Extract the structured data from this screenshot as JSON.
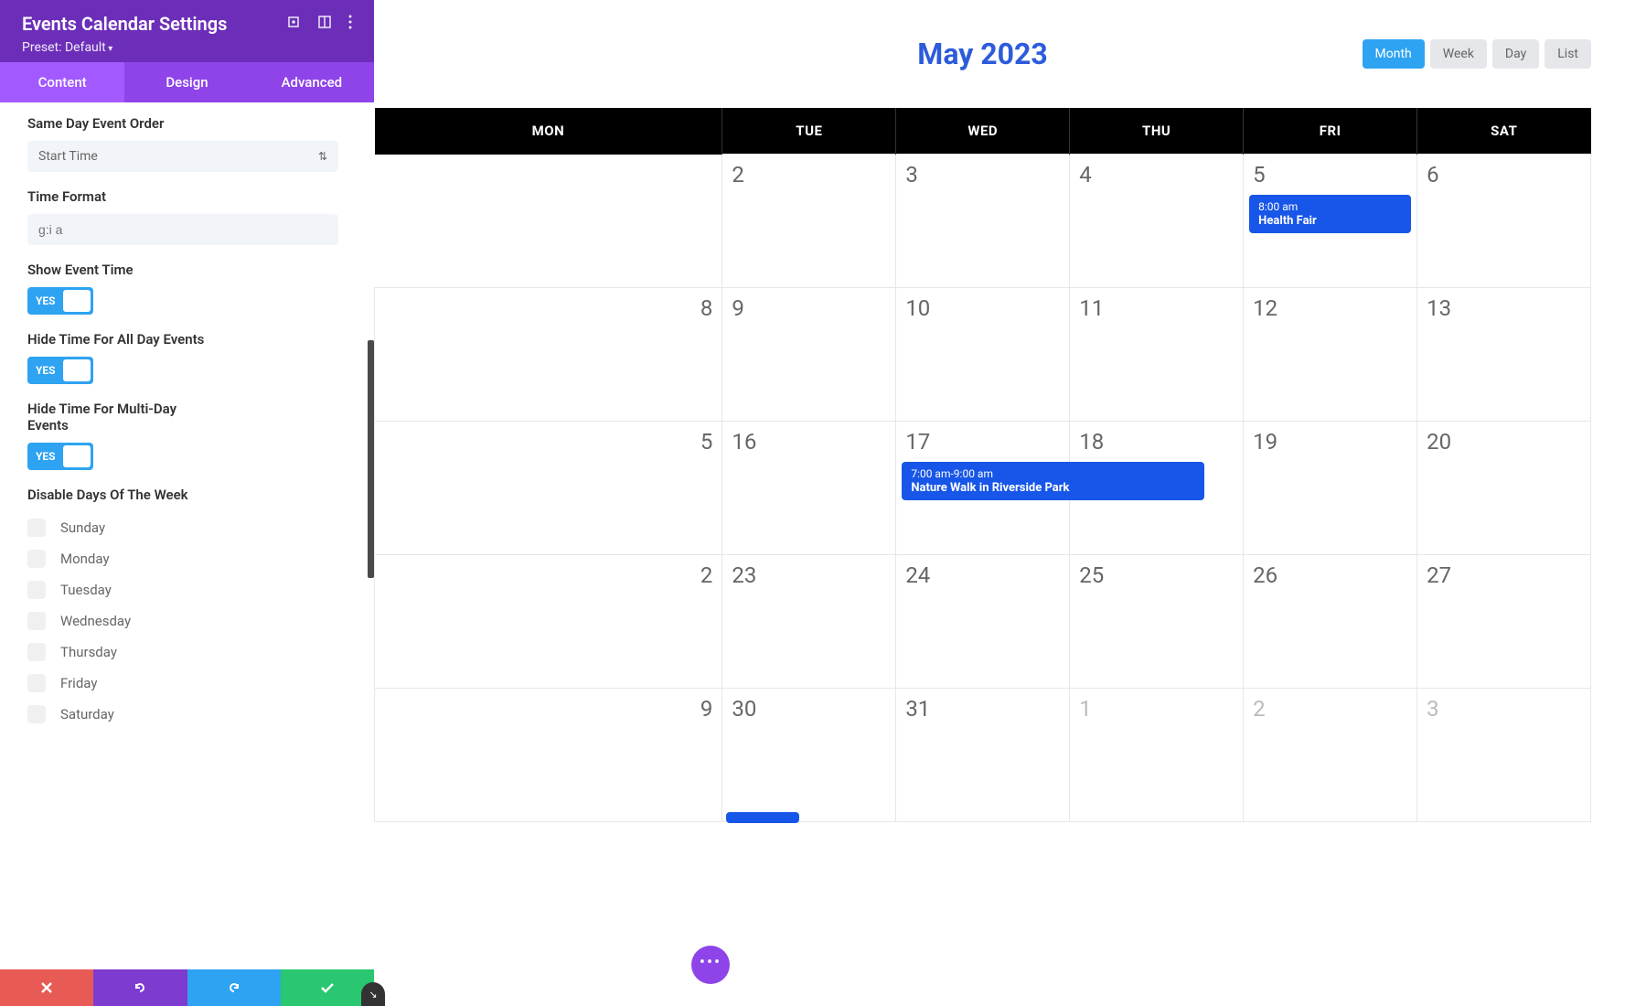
{
  "panel": {
    "title": "Events Calendar Settings",
    "preset": "Preset: Default",
    "tabs": [
      {
        "label": "Content",
        "active": true
      },
      {
        "label": "Design",
        "active": false
      },
      {
        "label": "Advanced",
        "active": false
      }
    ]
  },
  "settings": {
    "same_day_order": {
      "label": "Same Day Event Order",
      "value": "Start Time"
    },
    "time_format": {
      "label": "Time Format",
      "placeholder": "g:i a"
    },
    "show_event_time": {
      "label": "Show Event Time",
      "toggle": "YES"
    },
    "hide_all_day": {
      "label": "Hide Time For All Day Events",
      "toggle": "YES"
    },
    "hide_multi_day": {
      "label": "Hide Time For Multi-Day Events",
      "toggle": "YES"
    },
    "disable_days": {
      "label": "Disable Days Of The Week",
      "days": [
        "Sunday",
        "Monday",
        "Tuesday",
        "Wednesday",
        "Thursday",
        "Friday",
        "Saturday"
      ]
    }
  },
  "calendar": {
    "title": "May 2023",
    "views": [
      {
        "label": "Month",
        "active": true
      },
      {
        "label": "Week",
        "active": false
      },
      {
        "label": "Day",
        "active": false
      },
      {
        "label": "List",
        "active": false
      }
    ],
    "day_headers": [
      "MON",
      "TUE",
      "WED",
      "THU",
      "FRI",
      "SAT"
    ],
    "weeks": [
      [
        {
          "day": "",
          "hidden": true
        },
        {
          "day": "2"
        },
        {
          "day": "3"
        },
        {
          "day": "4"
        },
        {
          "day": "5",
          "event": {
            "time": "8:00 am",
            "title": "Health Fair"
          }
        },
        {
          "day": "6"
        }
      ],
      [
        {
          "day": "8",
          "partial": true
        },
        {
          "day": "9"
        },
        {
          "day": "10"
        },
        {
          "day": "11"
        },
        {
          "day": "12"
        },
        {
          "day": "13"
        }
      ],
      [
        {
          "day": "5",
          "partial": true
        },
        {
          "day": "16"
        },
        {
          "day": "17",
          "event": {
            "time": "7:00 am-9:00 am",
            "title": "Nature Walk in Riverside Park",
            "wide": true
          }
        },
        {
          "day": "18"
        },
        {
          "day": "19"
        },
        {
          "day": "20"
        }
      ],
      [
        {
          "day": "2",
          "partial": true
        },
        {
          "day": "23"
        },
        {
          "day": "24"
        },
        {
          "day": "25"
        },
        {
          "day": "26"
        },
        {
          "day": "27"
        }
      ],
      [
        {
          "day": "9",
          "partial": true
        },
        {
          "day": "30",
          "event": {
            "small": true
          }
        },
        {
          "day": "31"
        },
        {
          "day": "1",
          "other": true
        },
        {
          "day": "2",
          "other": true
        },
        {
          "day": "3",
          "other": true
        }
      ]
    ]
  }
}
